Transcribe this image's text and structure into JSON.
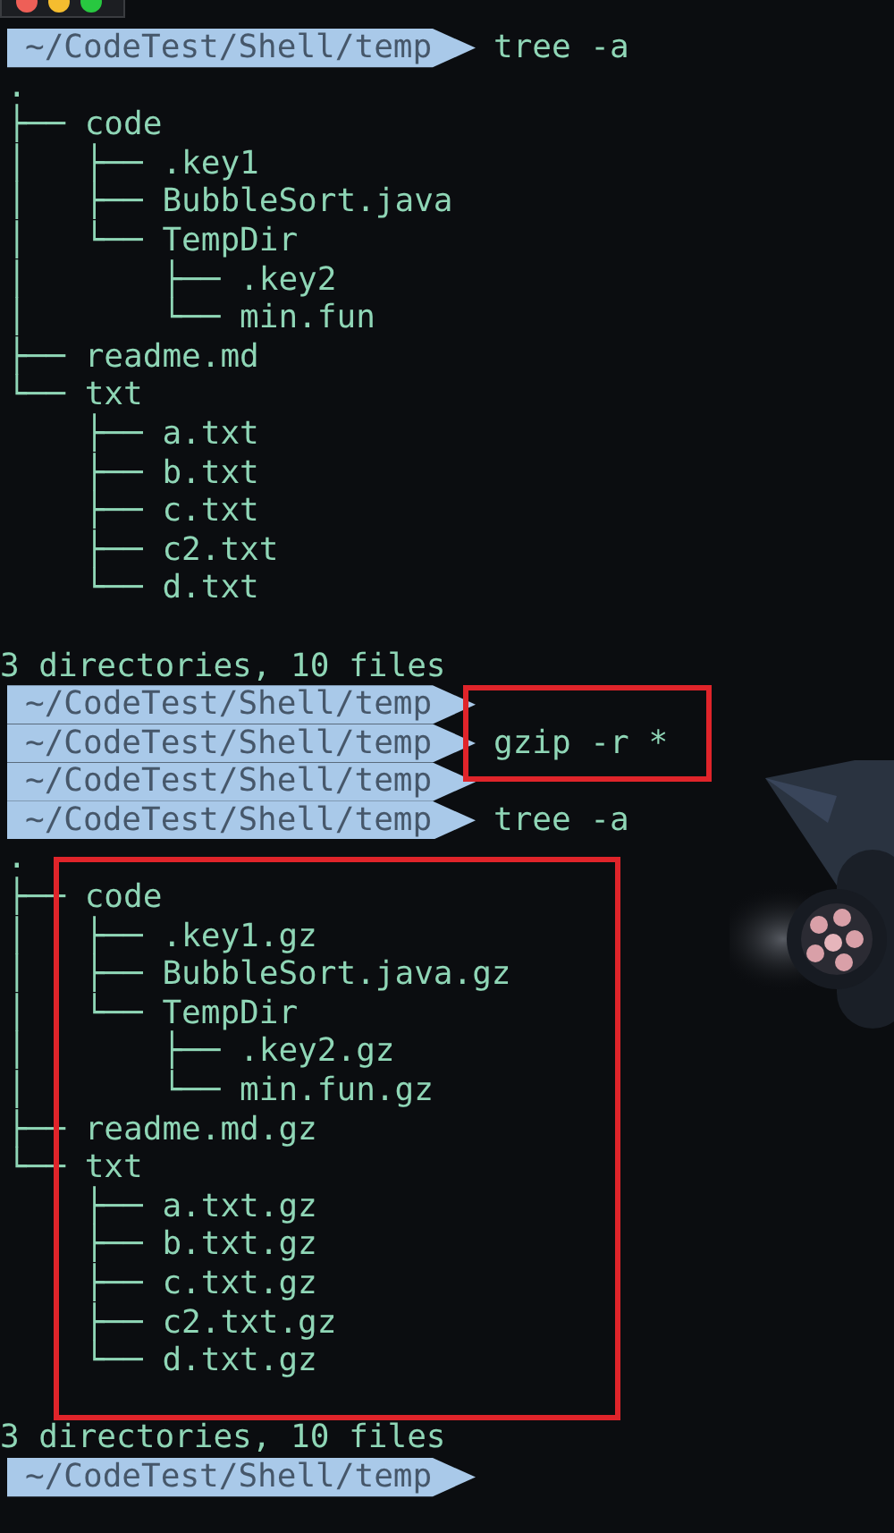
{
  "blocks": [
    {
      "kind": "prompt",
      "prompts": [
        {
          "path": "~/CodeTest/Shell/temp",
          "command": "tree -a"
        }
      ]
    },
    {
      "kind": "output",
      "lines": [
        ".",
        "├── code",
        "│   ├── .key1",
        "│   ├── BubbleSort.java",
        "│   └── TempDir",
        "│       ├── .key2",
        "│       └── min.fun",
        "├── readme.md",
        "└── txt",
        "    ├── a.txt",
        "    ├── b.txt",
        "    ├── c.txt",
        "    ├── c2.txt",
        "    └── d.txt"
      ]
    },
    {
      "kind": "summary",
      "text": "3 directories, 10 files"
    },
    {
      "kind": "prompt",
      "highlighted": true,
      "prompts": [
        {
          "path": "~/CodeTest/Shell/temp"
        },
        {
          "path": "~/CodeTest/Shell/temp",
          "command": "gzip -r *"
        },
        {
          "path": "~/CodeTest/Shell/temp"
        }
      ]
    },
    {
      "kind": "prompt",
      "prompts": [
        {
          "path": "~/CodeTest/Shell/temp",
          "command": "tree -a"
        }
      ]
    },
    {
      "kind": "output",
      "lines": [
        "."
      ]
    },
    {
      "kind": "output",
      "highlighted": true,
      "lines": [
        "├── code",
        "│   ├── .key1.gz",
        "│   ├── BubbleSort.java.gz",
        "│   └── TempDir",
        "│       ├── .key2.gz",
        "│       └── min.fun.gz",
        "├── readme.md.gz",
        "└── txt",
        "    ├── a.txt.gz",
        "    ├── b.txt.gz",
        "    ├── c.txt.gz",
        "    ├── c2.txt.gz",
        "    └── d.txt.gz"
      ]
    },
    {
      "kind": "summary",
      "text": "3 directories, 10 files"
    },
    {
      "kind": "prompt",
      "prompts": [
        {
          "path": "~/CodeTest/Shell/temp"
        }
      ]
    }
  ]
}
